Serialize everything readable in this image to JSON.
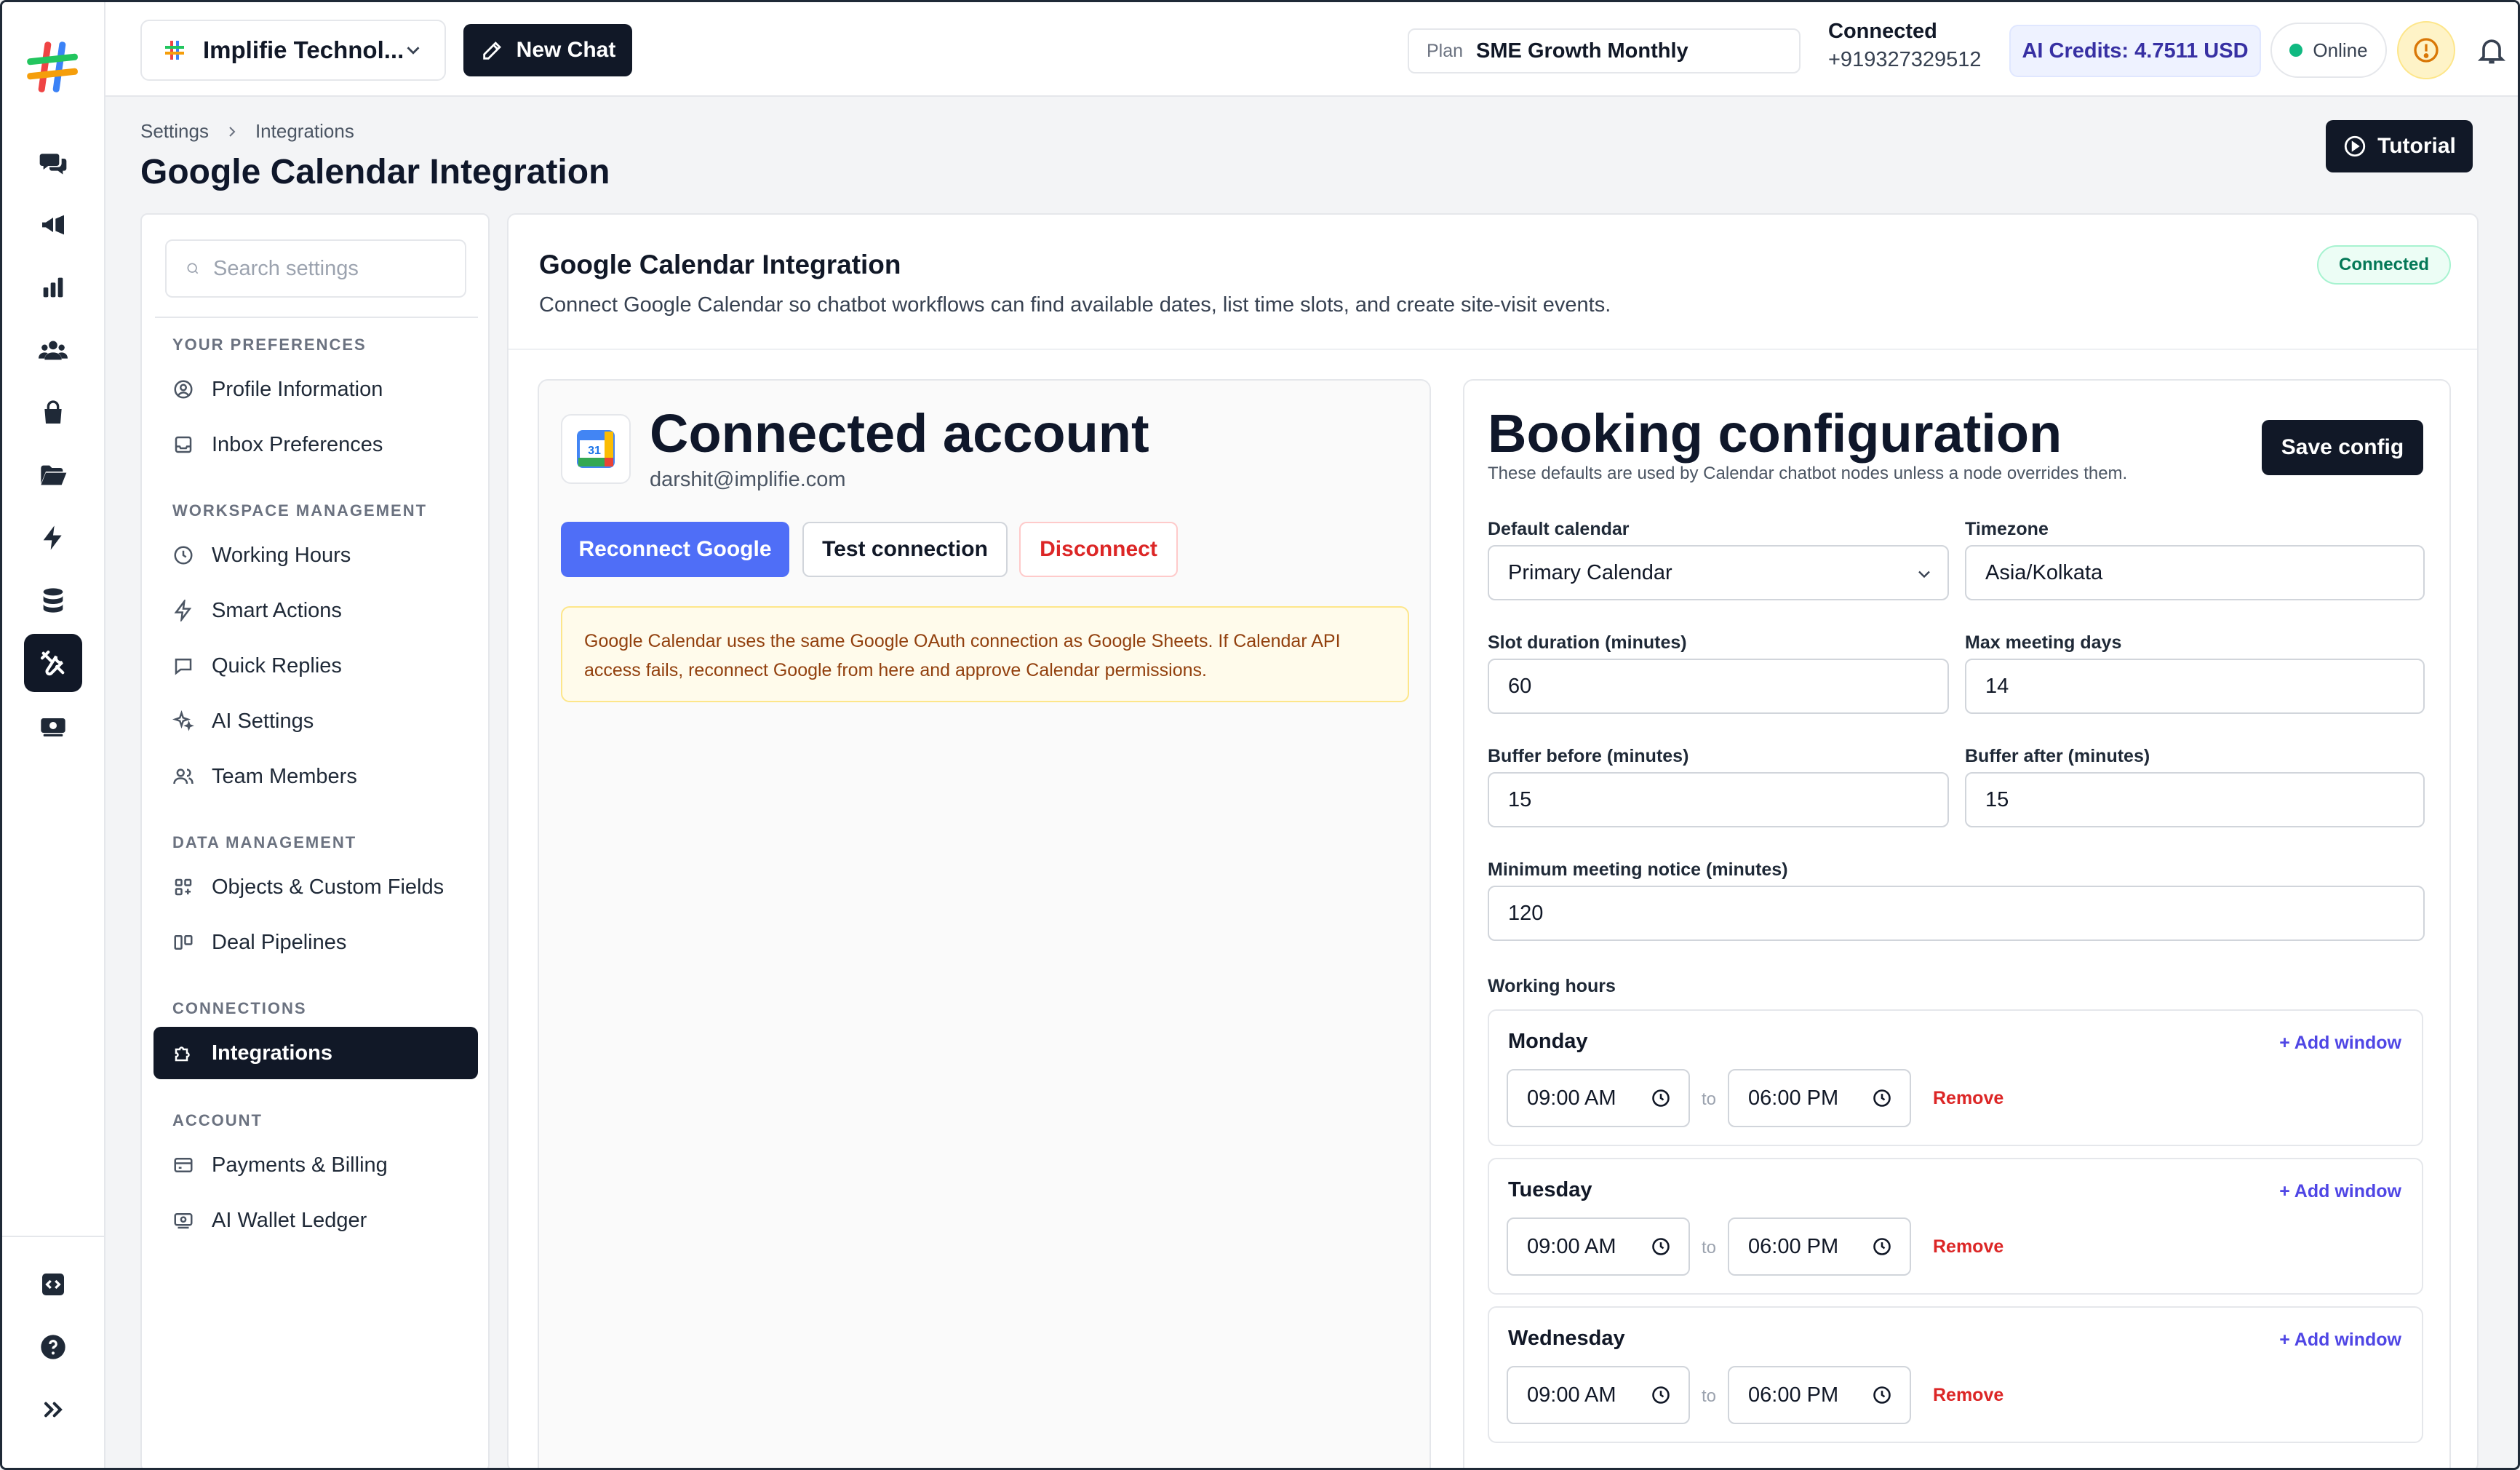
{
  "workspace": {
    "name": "Implifie Technol..."
  },
  "toolbar": {
    "new_chat_label": "New Chat",
    "plan_label": "Plan",
    "plan_value": "SME Growth Monthly",
    "connected_label": "Connected",
    "connected_number": "+919327329512",
    "credits": "AI Credits: 4.7511 USD",
    "status": "Online"
  },
  "page": {
    "breadcrumb": [
      "Settings",
      "Integrations"
    ],
    "title": "Google Calendar Integration",
    "tutorial_label": "Tutorial"
  },
  "settings_nav": {
    "search_placeholder": "Search settings",
    "sections": [
      {
        "title": "YOUR PREFERENCES",
        "items": [
          "Profile Information",
          "Inbox Preferences"
        ]
      },
      {
        "title": "WORKSPACE MANAGEMENT",
        "items": [
          "Working Hours",
          "Smart Actions",
          "Quick Replies",
          "AI Settings",
          "Team Members"
        ]
      },
      {
        "title": "DATA MANAGEMENT",
        "items": [
          "Objects & Custom Fields",
          "Deal Pipelines"
        ]
      },
      {
        "title": "CONNECTIONS",
        "items": [
          "Integrations"
        ]
      },
      {
        "title": "ACCOUNT",
        "items": [
          "Payments & Billing",
          "AI Wallet Ledger"
        ]
      }
    ],
    "active_item": "Integrations"
  },
  "integration": {
    "title": "Google Calendar Integration",
    "description": "Connect Google Calendar so chatbot workflows can find available dates, list time slots, and create site-visit events.",
    "status_badge": "Connected"
  },
  "account": {
    "title": "Connected account",
    "email": "darshit@implifie.com",
    "calendar_icon_number": "31",
    "reconnect_label": "Reconnect Google",
    "test_label": "Test connection",
    "disconnect_label": "Disconnect",
    "alert_text": "Google Calendar uses the same Google OAuth connection as Google Sheets. If Calendar API access fails, reconnect Google from here and approve Calendar permissions."
  },
  "booking": {
    "title": "Booking configuration",
    "subtitle": "These defaults are used by Calendar chatbot nodes unless a node overrides them.",
    "save_label": "Save config",
    "default_calendar_label": "Default calendar",
    "default_calendar_value": "Primary Calendar",
    "timezone_label": "Timezone",
    "timezone_value": "Asia/Kolkata",
    "slot_duration_label": "Slot duration (minutes)",
    "slot_duration_value": "60",
    "max_days_label": "Max meeting days",
    "max_days_value": "14",
    "buffer_before_label": "Buffer before (minutes)",
    "buffer_before_value": "15",
    "buffer_after_label": "Buffer after (minutes)",
    "buffer_after_value": "15",
    "min_notice_label": "Minimum meeting notice (minutes)",
    "min_notice_value": "120",
    "working_hours_label": "Working hours",
    "add_window_label": "+ Add window",
    "to_label": "to",
    "remove_label": "Remove",
    "days": [
      {
        "name": "Monday",
        "start": "09:00 AM",
        "end": "06:00 PM"
      },
      {
        "name": "Tuesday",
        "start": "09:00 AM",
        "end": "06:00 PM"
      },
      {
        "name": "Wednesday",
        "start": "09:00 AM",
        "end": "06:00 PM"
      }
    ]
  },
  "icons": {
    "rail": [
      "chats-icon",
      "campaigns-icon",
      "analytics-icon",
      "contacts-icon",
      "commerce-icon",
      "files-icon",
      "automation-icon",
      "database-icon",
      "settings-tools-icon",
      "wallet-icon",
      "embed-code-icon",
      "help-icon",
      "expand-icon"
    ]
  },
  "colors": {
    "accent": "#4f6ef7",
    "dark": "#111827",
    "success": "#047857",
    "danger": "#dc2626",
    "warning_bg": "#fffbeb"
  }
}
